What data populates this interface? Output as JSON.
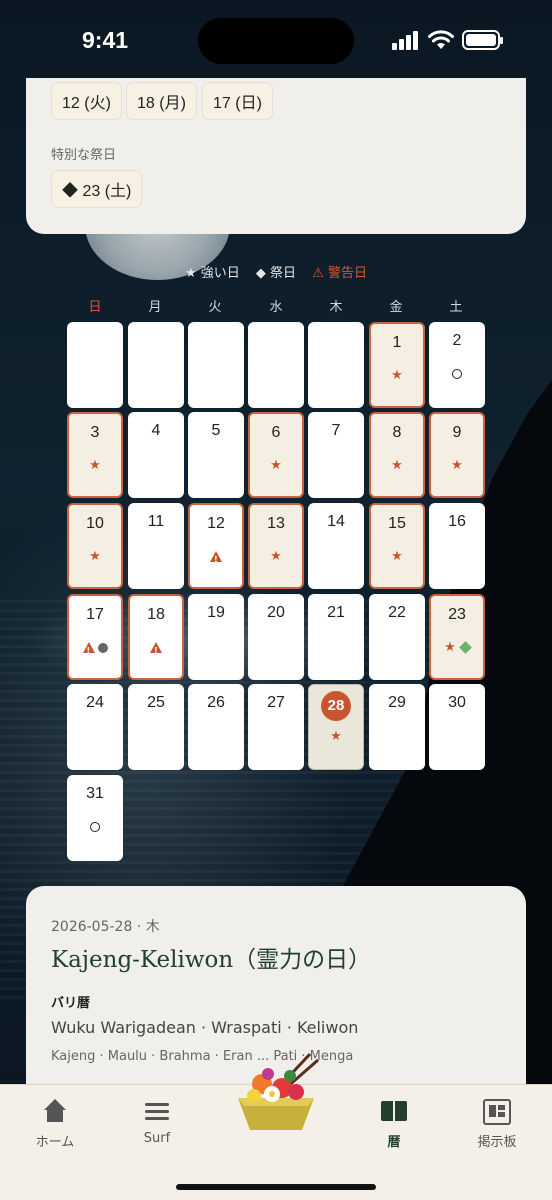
{
  "status_bar": {
    "time": "9:41"
  },
  "top_card": {
    "chips": [
      "12 (火)",
      "18 (月)",
      "17 (日)"
    ],
    "festival_label": "特別な祭日",
    "festival_chip": "◆ 23 (土)"
  },
  "legend": {
    "strong": "★ 強い日",
    "festival": "◆ 祭日",
    "warning": "⚠ 警告日"
  },
  "weekdays": [
    "日",
    "月",
    "火",
    "水",
    "木",
    "金",
    "土"
  ],
  "calendar": {
    "month": "2026-05",
    "today": 28,
    "days": [
      {
        "day": "1",
        "marks": "★",
        "type": "hl"
      },
      {
        "day": "2",
        "marks": "○",
        "type": "normal"
      },
      {
        "day": "3",
        "marks": "★",
        "type": "hl"
      },
      {
        "day": "4",
        "marks": "",
        "type": "normal"
      },
      {
        "day": "5",
        "marks": "",
        "type": "normal"
      },
      {
        "day": "6",
        "marks": "★",
        "type": "hl"
      },
      {
        "day": "7",
        "marks": "",
        "type": "normal"
      },
      {
        "day": "8",
        "marks": "★",
        "type": "hl"
      },
      {
        "day": "9",
        "marks": "★",
        "type": "hl"
      },
      {
        "day": "10",
        "marks": "★",
        "type": "hl"
      },
      {
        "day": "11",
        "marks": "",
        "type": "normal"
      },
      {
        "day": "12",
        "marks": "⚠",
        "type": "warn"
      },
      {
        "day": "13",
        "marks": "★",
        "type": "hl"
      },
      {
        "day": "14",
        "marks": "",
        "type": "normal"
      },
      {
        "day": "15",
        "marks": "★",
        "type": "hl"
      },
      {
        "day": "16",
        "marks": "",
        "type": "normal"
      },
      {
        "day": "17",
        "marks": "⚠●",
        "type": "warn"
      },
      {
        "day": "18",
        "marks": "⚠",
        "type": "warn"
      },
      {
        "day": "19",
        "marks": "",
        "type": "normal"
      },
      {
        "day": "20",
        "marks": "",
        "type": "normal"
      },
      {
        "day": "21",
        "marks": "",
        "type": "normal"
      },
      {
        "day": "22",
        "marks": "",
        "type": "normal"
      },
      {
        "day": "23",
        "marks": "★◆",
        "type": "hl"
      },
      {
        "day": "24",
        "marks": "",
        "type": "normal"
      },
      {
        "day": "25",
        "marks": "",
        "type": "normal"
      },
      {
        "day": "26",
        "marks": "",
        "type": "normal"
      },
      {
        "day": "27",
        "marks": "",
        "type": "normal"
      },
      {
        "day": "28",
        "marks": "★",
        "type": "today"
      },
      {
        "day": "29",
        "marks": "",
        "type": "normal"
      },
      {
        "day": "30",
        "marks": "",
        "type": "normal"
      },
      {
        "day": "31",
        "marks": "○",
        "type": "normal"
      }
    ]
  },
  "detail": {
    "date": "2026-05-28 · 木",
    "title": "Kajeng-Keliwon（霊力の日）",
    "calendar_label": "バリ暦",
    "wuku": "Wuku Warigadean · Wraspati · Keliwon",
    "sub": "Kajeng · Maulu · Brahma · Eran ... Pati · Menga"
  },
  "tabs": [
    {
      "label": "ホーム",
      "icon": "home-icon"
    },
    {
      "label": "Surf",
      "icon": "waves-icon"
    },
    {
      "label": "暦",
      "icon": "book-icon",
      "active": true
    },
    {
      "label": "掲示板",
      "icon": "board-icon"
    }
  ],
  "colors": {
    "accent": "#c8552f",
    "title_green": "#23402e",
    "festival_green": "#6db26a"
  }
}
